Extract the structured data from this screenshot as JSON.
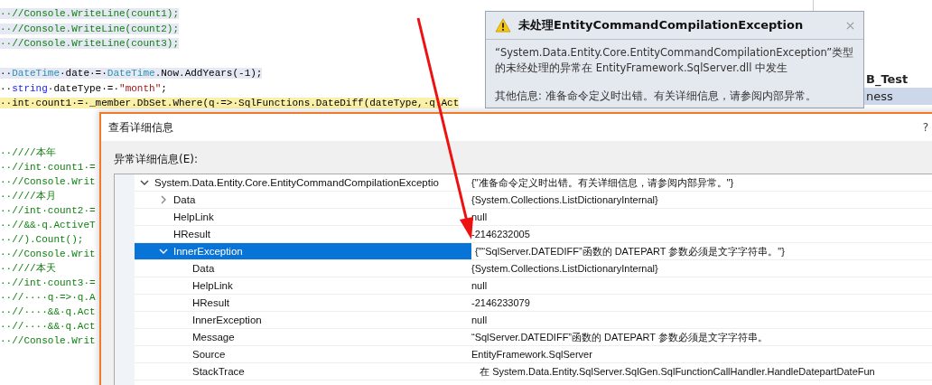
{
  "editor": {
    "top_lines": [
      {
        "kind": "selected",
        "tokens": [
          {
            "kind": "comment",
            "text": "··//Console.WriteLine(count1);"
          }
        ]
      },
      {
        "kind": "selected",
        "tokens": [
          {
            "kind": "comment",
            "text": "··//Console.WriteLine(count2);"
          }
        ]
      },
      {
        "kind": "selected",
        "tokens": [
          {
            "kind": "comment",
            "text": "··//Console.WriteLine(count3);"
          }
        ]
      },
      {
        "kind": "blank"
      },
      {
        "kind": "selected",
        "tokens": [
          {
            "kind": "plain",
            "text": "··"
          },
          {
            "kind": "type",
            "text": "DateTime"
          },
          {
            "kind": "plain",
            "text": "·date·=·"
          },
          {
            "kind": "type",
            "text": "DateTime"
          },
          {
            "kind": "plain",
            "text": ".Now.AddYears(-1);"
          }
        ]
      },
      {
        "kind": "plain",
        "tokens": [
          {
            "kind": "plain",
            "text": "··"
          },
          {
            "kind": "keyword",
            "text": "string"
          },
          {
            "kind": "plain",
            "text": "·dateType·=·"
          },
          {
            "kind": "string",
            "text": "\"month\""
          },
          {
            "kind": "plain",
            "text": ";"
          }
        ]
      },
      {
        "kind": "current",
        "tokens": [
          {
            "kind": "plain",
            "text": "··"
          },
          {
            "kind": "plain",
            "text": "int·count1·=·_member.DbSet.Where(q·=>·SqlFunctions.DateDiff(dateType,·q.Act"
          }
        ]
      }
    ],
    "lower_lines": [
      "··////本年",
      "··//int·count1·=",
      "··//Console.Writ",
      "··////本月",
      "··//int·count2·=",
      "··//&&·q.ActiveT",
      "··//).Count();",
      "··//Console.Writ",
      "··////本天",
      "··//int·count3·=",
      "··//····q·=>·q.A",
      "··//····&&·q.Act",
      "··//····&&·q.Act",
      "··//Console.Writ"
    ]
  },
  "side_panel": {
    "items": [
      {
        "text": "B_Test",
        "bold": true,
        "selected": false
      },
      {
        "text": "ness",
        "bold": false,
        "selected": true
      }
    ]
  },
  "exception_popup": {
    "title": "未处理EntityCommandCompilationException",
    "message": "“System.Data.Entity.Core.EntityCommandCompilationException”类型的未经处理的异常在 EntityFramework.SqlServer.dll 中发生",
    "details": "其他信息: 准备命令定义时出错。有关详细信息，请参阅内部异常。"
  },
  "details_dialog": {
    "title": "查看详细信息",
    "help": "?",
    "label": "异常详细信息(E):",
    "rows": [
      {
        "name": "System.Data.Entity.Core.EntityCommandCompilationExceptio",
        "value": "{\"准备命令定义时出错。有关详细信息，请参阅内部异常。\"}",
        "expanded": true,
        "selected": false,
        "children": [
          {
            "name": "Data",
            "value": "{System.Collections.ListDictionaryInternal}",
            "expanded": false,
            "selected": false
          },
          {
            "name": "HelpLink",
            "value": "null",
            "selected": false
          },
          {
            "name": "HResult",
            "value": "-2146232005",
            "selected": false
          },
          {
            "name": "InnerException",
            "value": "{\"“SqlServer.DATEDIFF”函数的 DATEPART 参数必须是文字字符串。\"}",
            "expanded": true,
            "selected": true,
            "children": [
              {
                "name": "Data",
                "value": "{System.Collections.ListDictionaryInternal}",
                "selected": false
              },
              {
                "name": "HelpLink",
                "value": "null",
                "selected": false
              },
              {
                "name": "HResult",
                "value": "-2146233079",
                "selected": false
              },
              {
                "name": "InnerException",
                "value": "null",
                "selected": false
              },
              {
                "name": "Message",
                "value": "“SqlServer.DATEDIFF”函数的 DATEPART 参数必须是文字字符串。",
                "selected": false
              },
              {
                "name": "Source",
                "value": "EntityFramework.SqlServer",
                "selected": false
              },
              {
                "name": "StackTrace",
                "value": "   在 System.Data.Entity.SqlServer.SqlGen.SqlFunctionCallHandler.HandleDatepartDateFun",
                "selected": false
              }
            ]
          }
        ]
      }
    ]
  }
}
